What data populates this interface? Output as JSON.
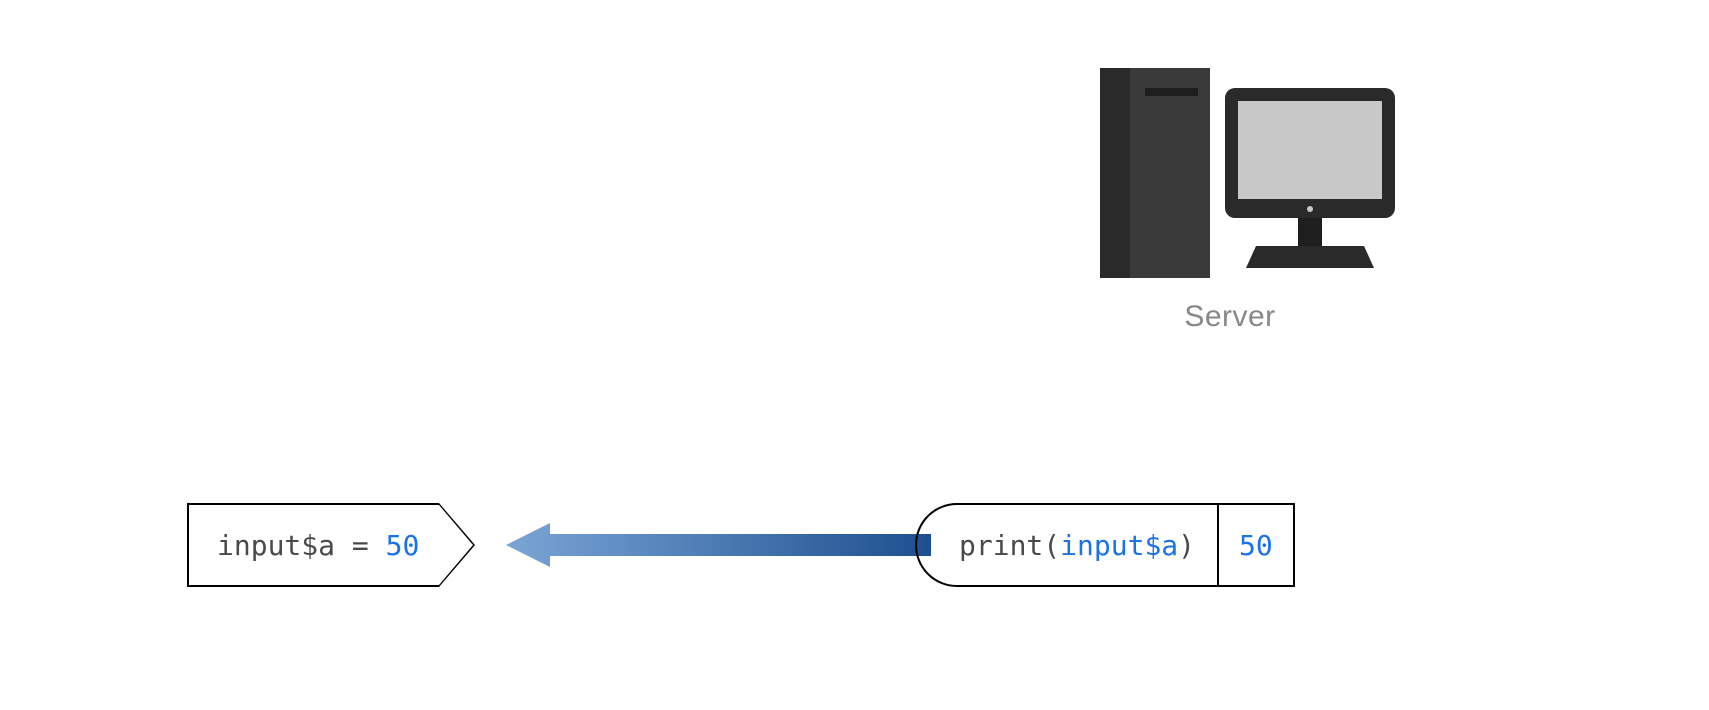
{
  "server": {
    "label": "Server"
  },
  "left": {
    "var": "input$a",
    "equals": " = ",
    "value": "50"
  },
  "right": {
    "fn": "print",
    "open": "(",
    "arg": "input$a",
    "close": ")",
    "output": "50"
  }
}
